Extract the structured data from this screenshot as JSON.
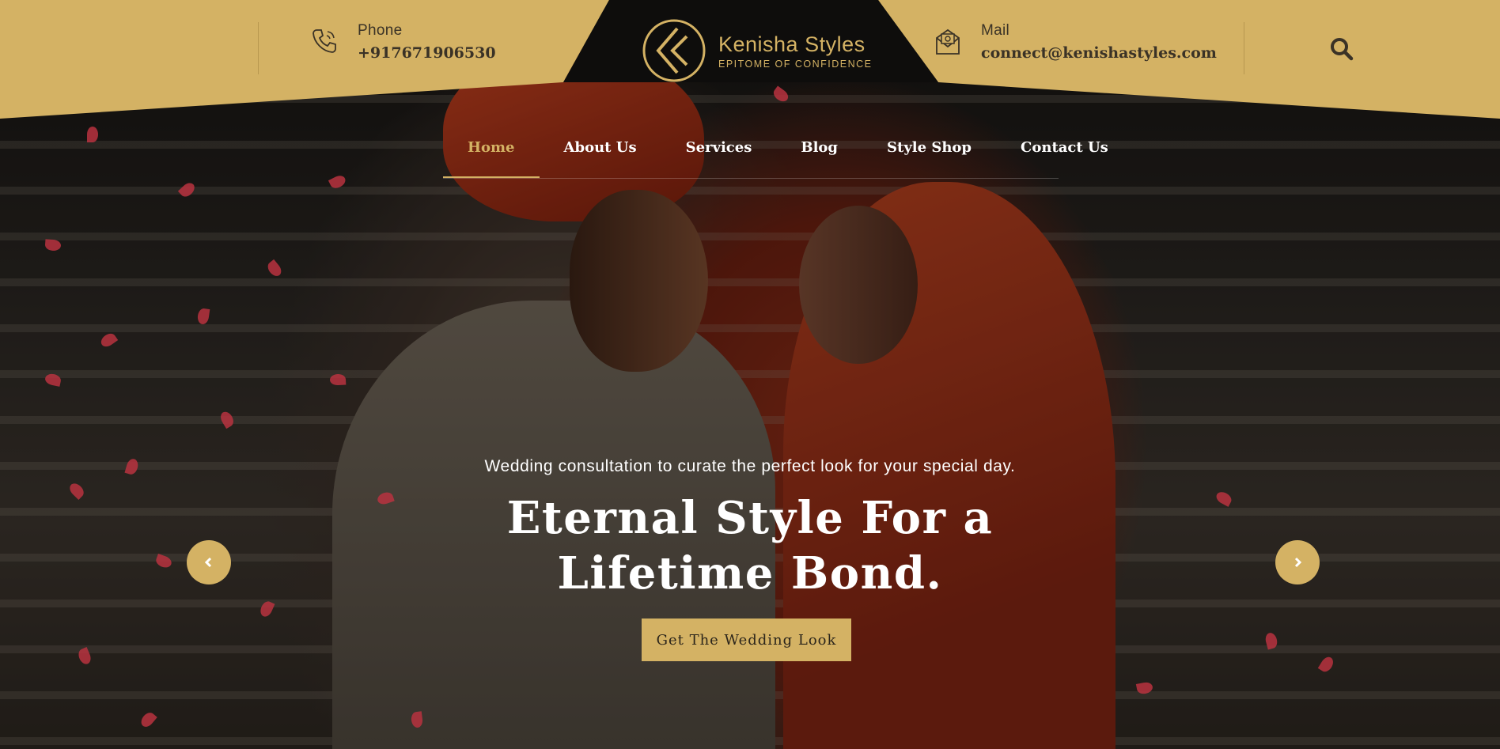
{
  "header": {
    "phone": {
      "label": "Phone",
      "value": "+917671906530",
      "icon": "phone-icon"
    },
    "mail": {
      "label": "Mail",
      "value": "connect@kenishastyles.com",
      "icon": "mail-icon"
    },
    "logo": {
      "title": "Kenisha Styles",
      "tagline": "EPITOME OF CONFIDENCE"
    },
    "search_icon": "search-icon"
  },
  "nav": {
    "items": [
      {
        "label": "Home",
        "active": true
      },
      {
        "label": "About Us"
      },
      {
        "label": "Services"
      },
      {
        "label": "Blog"
      },
      {
        "label": "Style Shop"
      },
      {
        "label": "Contact Us"
      }
    ]
  },
  "hero": {
    "subtitle": "Wedding consultation to curate the perfect look for your special day.",
    "title": "Eternal Style For a Lifetime Bond.",
    "cta": "Get The Wedding Look",
    "prev_icon": "chevron-left-icon",
    "next_icon": "chevron-right-icon"
  },
  "colors": {
    "gold": "#d4b264",
    "dark": "#111111",
    "text_dark": "#3a3226"
  }
}
